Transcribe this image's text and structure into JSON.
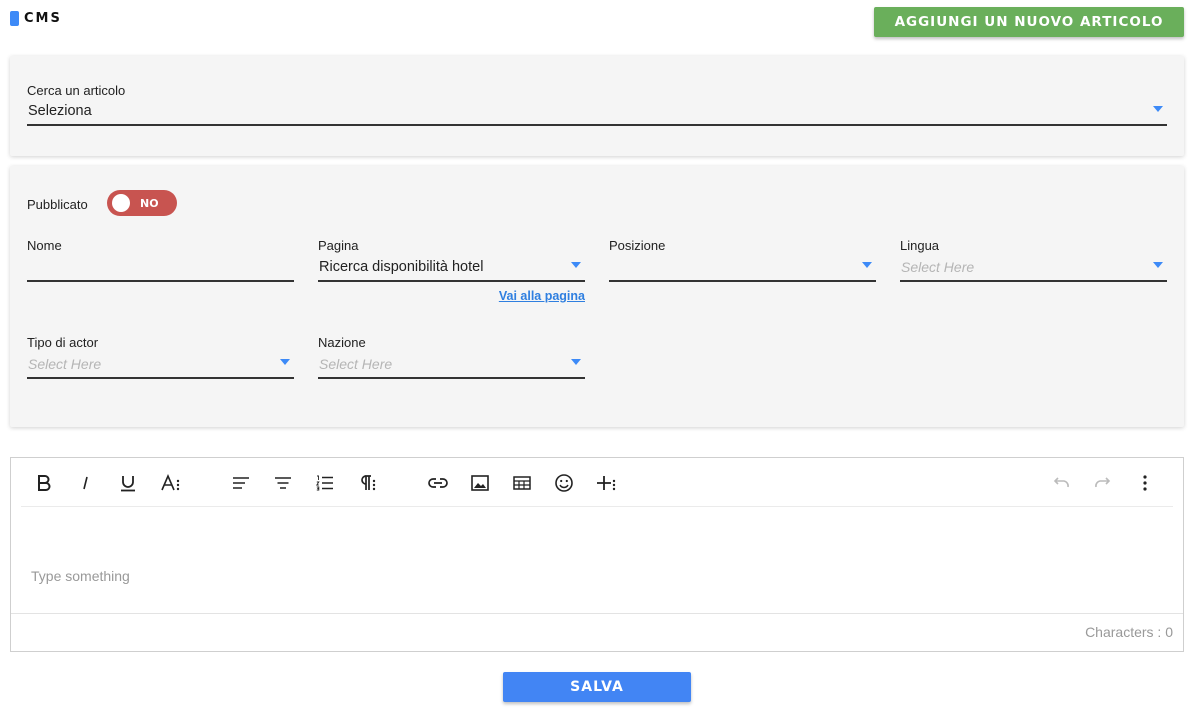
{
  "header": {
    "logo_text": "CMS",
    "add_button_label": "AGGIUNGI UN NUOVO ARTICOLO"
  },
  "search": {
    "label": "Cerca un articolo",
    "value": "Seleziona"
  },
  "form": {
    "published_label": "Pubblicato",
    "published_toggle_text": "NO",
    "published": false,
    "name_label": "Nome",
    "name_value": "",
    "page_label": "Pagina",
    "page_value": "Ricerca disponibilità hotel",
    "go_to_page_link": "Vai alla pagina",
    "position_label": "Posizione",
    "position_value": "",
    "language_label": "Lingua",
    "language_placeholder": "Select Here",
    "actor_type_label": "Tipo di actor",
    "actor_type_placeholder": "Select Here",
    "nation_label": "Nazione",
    "nation_placeholder": "Select Here"
  },
  "editor": {
    "placeholder": "Type something",
    "characters_label": "Characters : ",
    "characters_count": "0"
  },
  "footer": {
    "save_label": "SALVA"
  },
  "colors": {
    "accent": "#3d8af7",
    "add_button": "#6aaf5b",
    "toggle_off": "#c85450",
    "save_button": "#4285f4",
    "card_bg": "#f5f5f5"
  }
}
